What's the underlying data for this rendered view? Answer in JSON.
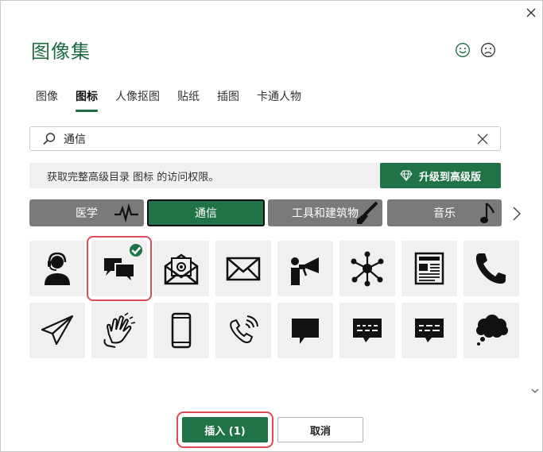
{
  "dialog": {
    "title": "图像集",
    "feedback": {
      "happy_icon": "smiley-icon",
      "sad_icon": "frown-icon"
    },
    "close_icon": "close-icon"
  },
  "tabs": [
    {
      "label": "图像",
      "active": false
    },
    {
      "label": "图标",
      "active": true
    },
    {
      "label": "人像抠图",
      "active": false
    },
    {
      "label": "贴纸",
      "active": false
    },
    {
      "label": "插图",
      "active": false
    },
    {
      "label": "卡通人物",
      "active": false
    }
  ],
  "search": {
    "value": "通信",
    "icon": "search-icon",
    "clear_icon": "close-icon"
  },
  "banner": {
    "text": "获取完整高级目录 图标 的访问权限。",
    "upgrade_label": "升级到高级版",
    "upgrade_icon": "diamond-icon"
  },
  "categories": [
    {
      "label": "医学",
      "active": false,
      "icon": "heartbeat-icon"
    },
    {
      "label": "通信",
      "active": true,
      "icon": ""
    },
    {
      "label": "工具和建筑物",
      "active": false,
      "icon": "paintbrush-icon"
    },
    {
      "label": "音乐",
      "active": false,
      "icon": "music-note-icon"
    }
  ],
  "icons": [
    {
      "name": "headset-user-icon",
      "selected": false
    },
    {
      "name": "chat-bubbles-icon",
      "selected": true
    },
    {
      "name": "email-envelope-icon",
      "selected": false
    },
    {
      "name": "envelope-icon",
      "selected": false
    },
    {
      "name": "megaphone-person-icon",
      "selected": false
    },
    {
      "name": "network-hub-icon",
      "selected": false
    },
    {
      "name": "newspaper-icon",
      "selected": false
    },
    {
      "name": "phone-handset-icon",
      "selected": false
    },
    {
      "name": "paper-plane-icon",
      "selected": false
    },
    {
      "name": "sign-language-icon",
      "selected": false
    },
    {
      "name": "smartphone-icon",
      "selected": false
    },
    {
      "name": "phone-ringing-icon",
      "selected": false
    },
    {
      "name": "speech-bubble-icon",
      "selected": false
    },
    {
      "name": "message-text-icon",
      "selected": false
    },
    {
      "name": "message-lines-icon",
      "selected": false
    },
    {
      "name": "thought-cloud-icon",
      "selected": false
    }
  ],
  "footer": {
    "insert_label": "插入 (1)",
    "cancel_label": "取消"
  },
  "colors": {
    "accent": "#1f7346",
    "title_green": "#1e6b44",
    "category_gray": "#7a7a7a",
    "highlight_red": "#e04a55",
    "tile_bg": "#f0f0f0"
  }
}
